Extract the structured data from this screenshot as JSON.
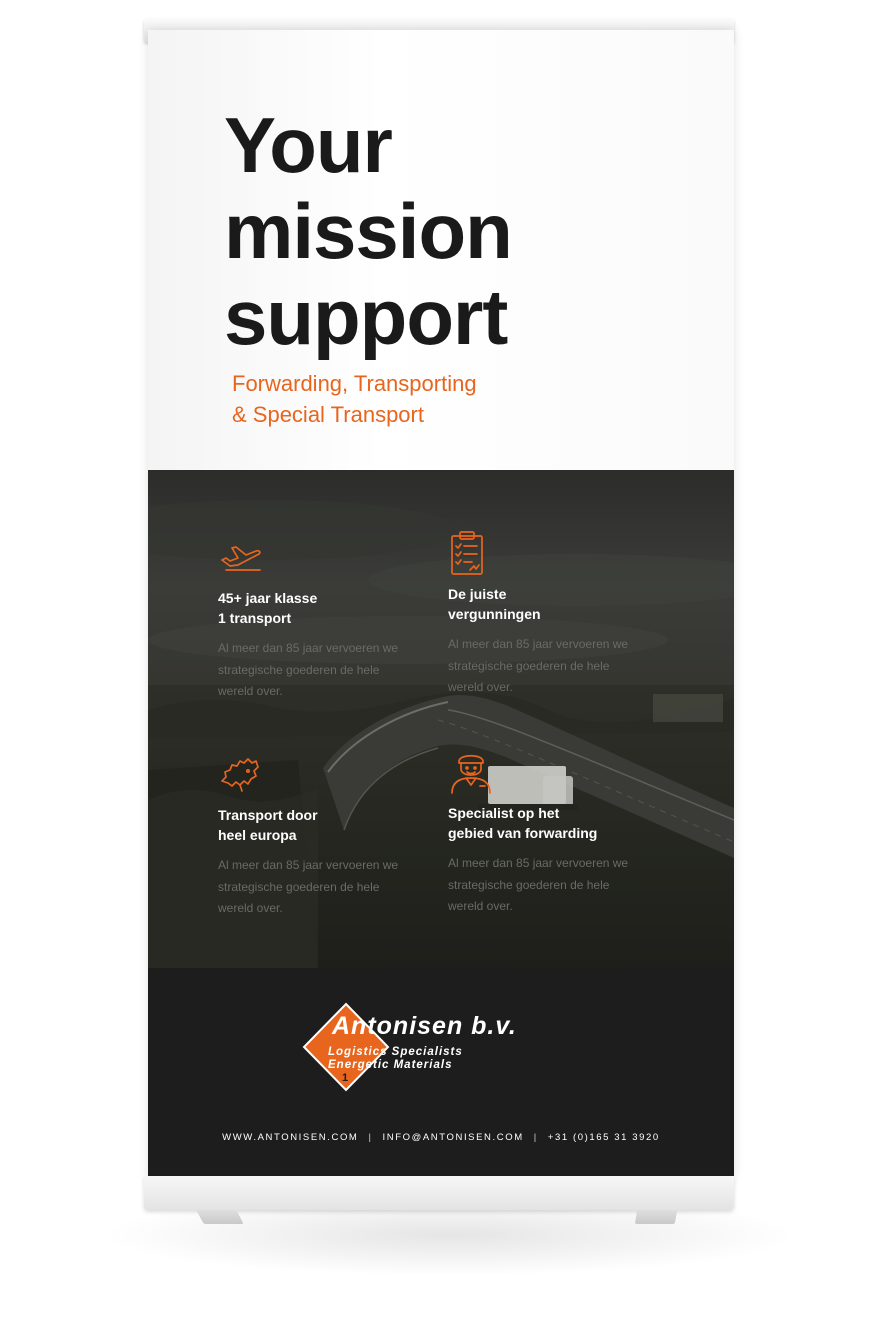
{
  "headline": [
    "Your",
    "mission",
    "support"
  ],
  "subtitle": [
    "Forwarding, Transporting",
    "& Special Transport"
  ],
  "features": [
    {
      "icon": "airplane-icon",
      "title": [
        "45+ jaar klasse",
        "1 transport"
      ],
      "description": [
        "Al meer dan 85 jaar vervoeren we",
        "strategische goederen de hele",
        "wereld over."
      ]
    },
    {
      "icon": "clipboard-checklist-icon",
      "title": [
        "De juiste",
        "vergunningen"
      ],
      "description": [
        "Al meer dan 85 jaar vervoeren we",
        "strategische goederen de hele",
        "wereld over."
      ]
    },
    {
      "icon": "europe-map-icon",
      "title": [
        "Transport door",
        "heel europa"
      ],
      "description": [
        "Al meer dan 85 jaar vervoeren we",
        "strategische goederen de hele",
        "wereld over."
      ]
    },
    {
      "icon": "driver-person-icon",
      "title": [
        "Specialist op het",
        "gebied van forwarding"
      ],
      "description": [
        "Al meer dan 85 jaar vervoeren we",
        "strategische goederen de hele",
        "wereld over."
      ]
    }
  ],
  "logo": {
    "name": "Antonisen b.v.",
    "line1": "Logistics Specialists",
    "line2": "Energetic Materials",
    "number": "1"
  },
  "contact": {
    "website": "WWW.ANTONISEN.COM",
    "email": "INFO@ANTONISEN.COM",
    "phone": "+31 (0)165 31 3920",
    "separator": "|"
  },
  "colors": {
    "accent": "#e8651d",
    "headline": "#1a1a1a",
    "dark_panel": "#1d1d1d",
    "muted_text": "#6a6a66"
  }
}
